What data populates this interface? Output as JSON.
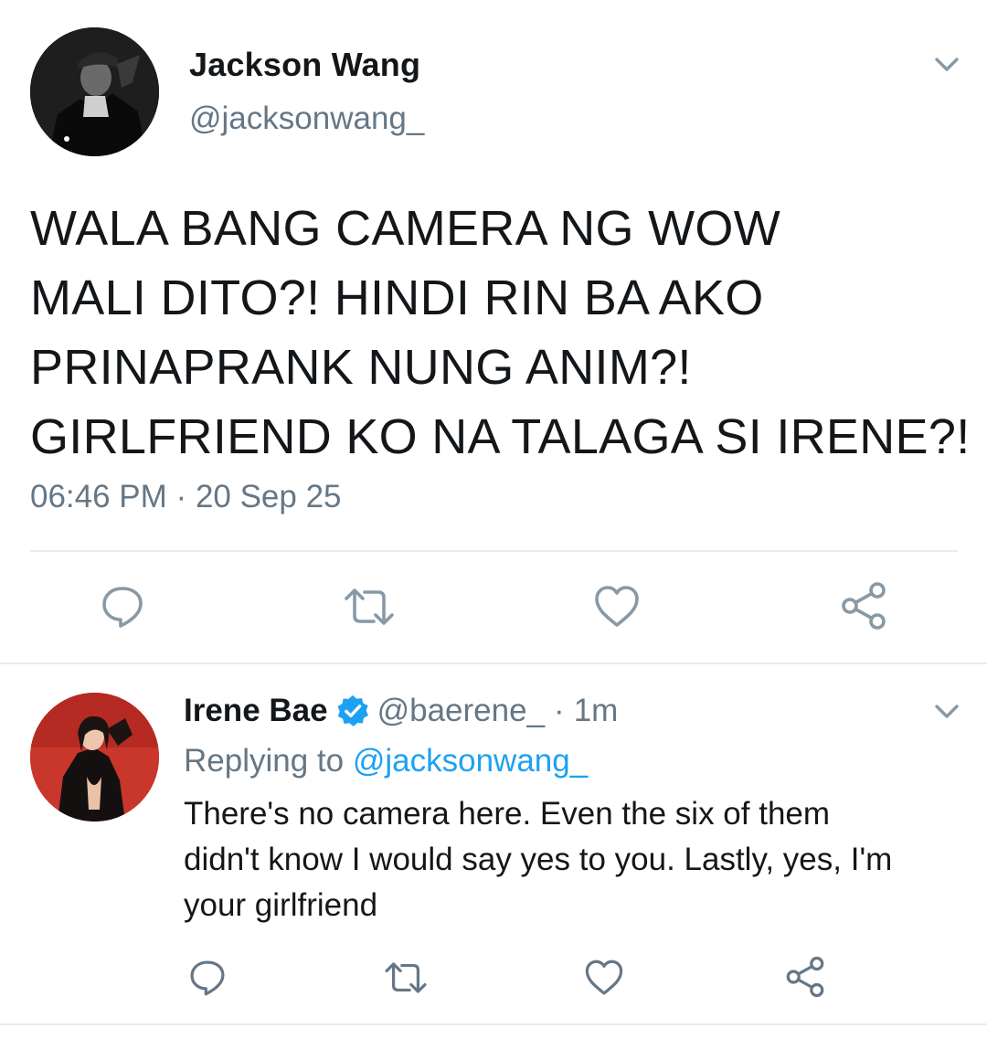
{
  "main_tweet": {
    "author_name": "Jackson Wang",
    "author_handle": "@jacksonwang_",
    "text": "WALA BANG CAMERA NG WOW MALI DITO?! HINDI RIN BA AKO PRINAPRANK NUNG ANIM?! GIRLFRIEND KO NA TALAGA SI IRENE?!",
    "text_lines": [
      "WALA BANG CAMERA NG WOW",
      "MALI DITO?! HINDI RIN BA AKO",
      "PRINAPRANK NUNG ANIM?!",
      "GIRLFRIEND KO NA TALAGA SI IRENE?!"
    ],
    "time": "06:46 PM",
    "separator": "·",
    "date": "20 Sep 25",
    "icons": {
      "menu": "chevron-down-icon",
      "reply": "reply-icon",
      "retweet": "retweet-icon",
      "like": "heart-icon",
      "share": "share-icon"
    }
  },
  "reply_tweet": {
    "author_name": "Irene Bae",
    "verified": true,
    "author_handle": "@baerene_",
    "separator": "·",
    "time_ago": "1m",
    "replying_prefix": "Replying to",
    "replying_to": "@jacksonwang_",
    "text_lines": [
      "There's no camera here. Even the six of them",
      "didn't know I would say yes to you. Lastly, yes, I'm",
      "your girlfriend"
    ],
    "icons": {
      "menu": "chevron-down-icon",
      "reply": "reply-icon",
      "retweet": "retweet-icon",
      "like": "heart-icon",
      "share": "share-icon"
    }
  },
  "colors": {
    "text_primary": "#14171a",
    "text_secondary": "#657786",
    "link": "#1da1f2",
    "verified": "#1da1f2",
    "divider": "#e6ecf0"
  }
}
